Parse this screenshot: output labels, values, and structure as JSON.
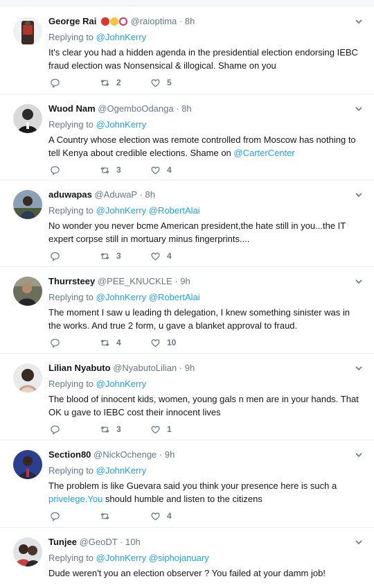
{
  "colors": {
    "accent": "#1da1f2",
    "muted": "#657786",
    "text": "#14171a",
    "divider": "#e6ecf0"
  },
  "icons": {
    "reply": "reply-icon",
    "retweet": "retweet-icon",
    "like": "heart-icon",
    "more": "chevron-down-icon"
  },
  "tweets": [
    {
      "name": "George Rai",
      "handle": "@raioptima",
      "dot": "·",
      "time": "8h",
      "replying_prefix": "Replying to ",
      "mentions": [
        "@JohnKerry"
      ],
      "text": "It's clear you had a hidden agenda in the presidential election  endorsing IEBC fraud election was Nonsensical & illogical. Shame on you",
      "retweets": "2",
      "likes": "5"
    },
    {
      "name": "Wuod Nam",
      "handle": "@OgemboOdanga",
      "dot": "·",
      "time": "8h",
      "replying_prefix": "Replying to ",
      "mentions": [
        "@JohnKerry"
      ],
      "text": "A Country whose election was remote controlled from Moscow has nothing  to tell Kenya about credible elections. Shame on ",
      "text_link": "@CarterCenter",
      "retweets": "3",
      "likes": "4"
    },
    {
      "name": "aduwapas",
      "handle": "@AduwaP",
      "dot": "·",
      "time": "8h",
      "replying_prefix": "Replying to ",
      "mentions": [
        "@JohnKerry",
        "@RobertAlai"
      ],
      "text": "No wonder you never bcme American president,the hate still in you...the IT expert corpse still in mortuary minus fingerprints....",
      "retweets": "3",
      "likes": "4"
    },
    {
      "name": "Thurrsteey",
      "handle": "@PEE_KNUCKLE",
      "dot": "·",
      "time": "9h",
      "replying_prefix": "Replying to ",
      "mentions": [
        "@JohnKerry",
        "@RobertAlai"
      ],
      "text": "The moment I saw u leading th delegation, I knew something sinister was in the works. And true 2 form, u gave a blanket approval to fraud.",
      "retweets": "4",
      "likes": "10"
    },
    {
      "name": "Lilian Nyabuto",
      "handle": "@NyabutoLilian",
      "dot": "·",
      "time": "9h",
      "replying_prefix": "Replying to ",
      "mentions": [
        "@JohnKerry"
      ],
      "text": "The blood of innocent kids, women, young gals n men are in your hands. That OK u gave to IEBC cost their innocent lives",
      "retweets": "3",
      "likes": "1"
    },
    {
      "name": "Section80",
      "handle": "@NickOchenge",
      "dot": "·",
      "time": "9h",
      "replying_prefix": "Replying to ",
      "mentions": [
        "@JohnKerry"
      ],
      "text": "The problem is like Guevara said you think your presence here is such a ",
      "text_link": "privelege.You",
      "text_after": " should humble and listen to the citizens",
      "retweets": "",
      "likes": "4"
    },
    {
      "name": "Tunjee",
      "handle": "@GeoDT",
      "dot": "·",
      "time": "10h",
      "replying_prefix": "Replying to ",
      "mentions": [
        "@JohnKerry",
        "@siphojanuary"
      ],
      "text": "Dude weren't you an election observer ? You failed at your damm job!",
      "retweets": "",
      "likes": ""
    }
  ]
}
